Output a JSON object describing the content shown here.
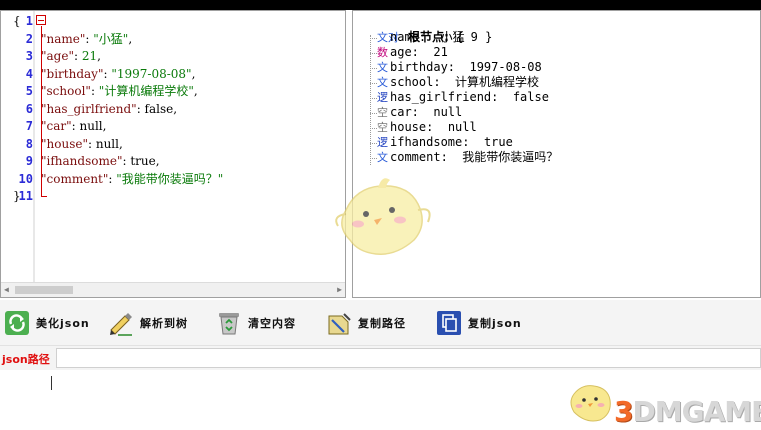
{
  "editor": {
    "line_numbers": [
      "1",
      "2",
      "3",
      "4",
      "5",
      "6",
      "7",
      "8",
      "9",
      "10",
      "11"
    ],
    "lines": [
      [
        {
          "t": "{",
          "c": "lit"
        }
      ],
      [
        {
          "t": "\"name\"",
          "c": "key"
        },
        {
          "t": ": ",
          "c": "lit"
        },
        {
          "t": "\"小猛\"",
          "c": "str"
        },
        {
          "t": ",",
          "c": "lit"
        }
      ],
      [
        {
          "t": "\"age\"",
          "c": "key"
        },
        {
          "t": ": ",
          "c": "lit"
        },
        {
          "t": "21",
          "c": "num"
        },
        {
          "t": ",",
          "c": "lit"
        }
      ],
      [
        {
          "t": "\"birthday\"",
          "c": "key"
        },
        {
          "t": ": ",
          "c": "lit"
        },
        {
          "t": "\"1997-08-08\"",
          "c": "str"
        },
        {
          "t": ",",
          "c": "lit"
        }
      ],
      [
        {
          "t": "\"school\"",
          "c": "key"
        },
        {
          "t": ": ",
          "c": "lit"
        },
        {
          "t": "\"计算机编程学校\"",
          "c": "str"
        },
        {
          "t": ",",
          "c": "lit"
        }
      ],
      [
        {
          "t": "\"has_girlfriend\"",
          "c": "key"
        },
        {
          "t": ": false,",
          "c": "lit"
        }
      ],
      [
        {
          "t": "\"car\"",
          "c": "key"
        },
        {
          "t": ": null,",
          "c": "lit"
        }
      ],
      [
        {
          "t": "\"house\"",
          "c": "key"
        },
        {
          "t": ": null,",
          "c": "lit"
        }
      ],
      [
        {
          "t": "\"ifhandsome\"",
          "c": "key"
        },
        {
          "t": ": true,",
          "c": "lit"
        }
      ],
      [
        {
          "t": "\"comment\"",
          "c": "key"
        },
        {
          "t": ": ",
          "c": "lit"
        },
        {
          "t": "\"我能带你装逼吗？\"",
          "c": "str"
        }
      ],
      [
        {
          "t": "}",
          "c": "lit"
        }
      ]
    ]
  },
  "tree": {
    "root": {
      "icon": "对",
      "label": "根节点:",
      "count": "{ 9 }"
    },
    "items": [
      {
        "icon": "文",
        "type": "str",
        "key": "name:",
        "value": "小猛"
      },
      {
        "icon": "数",
        "type": "num",
        "key": "age:",
        "value": "21"
      },
      {
        "icon": "文",
        "type": "str",
        "key": "birthday:",
        "value": "1997-08-08"
      },
      {
        "icon": "文",
        "type": "str",
        "key": "school:",
        "value": "计算机编程学校"
      },
      {
        "icon": "逻",
        "type": "bool",
        "key": "has_girlfriend:",
        "value": "false"
      },
      {
        "icon": "空",
        "type": "null",
        "key": "car:",
        "value": "null"
      },
      {
        "icon": "空",
        "type": "null",
        "key": "house:",
        "value": "null"
      },
      {
        "icon": "逻",
        "type": "bool",
        "key": "ifhandsome:",
        "value": "true"
      },
      {
        "icon": "文",
        "type": "str",
        "key": "comment:",
        "value": "我能带你装逼吗？"
      }
    ]
  },
  "toolbar": {
    "beautify_label": "美化json",
    "parse_label": "解析到树",
    "clear_label": "清空内容",
    "copy_path_label": "复制路径",
    "copy_json_label": "复制json"
  },
  "pathbar": {
    "label": "json路径",
    "value": ""
  },
  "watermark": {
    "three": "3",
    "rest": "DMGAME"
  },
  "colors": {
    "path_label": "#e01010",
    "key": "#7a0d0d",
    "string": "#0a7a0a",
    "line_number": "#2b2bd6",
    "fold": "#d00000"
  }
}
